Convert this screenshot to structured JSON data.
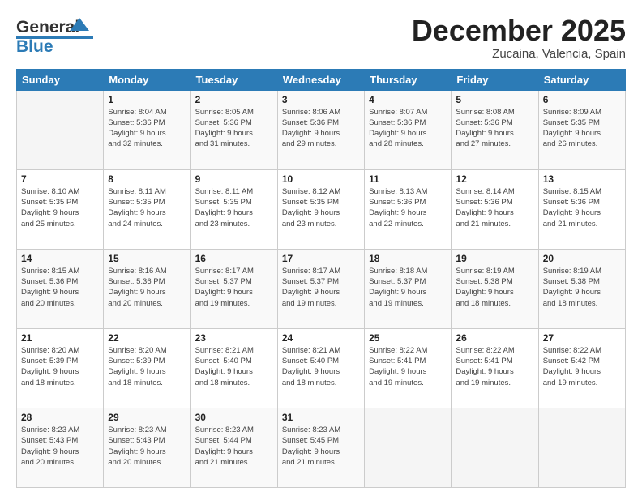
{
  "header": {
    "logo_general": "General",
    "logo_blue": "Blue",
    "title": "December 2025",
    "subtitle": "Zucaina, Valencia, Spain"
  },
  "calendar": {
    "days_of_week": [
      "Sunday",
      "Monday",
      "Tuesday",
      "Wednesday",
      "Thursday",
      "Friday",
      "Saturday"
    ],
    "weeks": [
      [
        {
          "day": "",
          "info": ""
        },
        {
          "day": "1",
          "info": "Sunrise: 8:04 AM\nSunset: 5:36 PM\nDaylight: 9 hours\nand 32 minutes."
        },
        {
          "day": "2",
          "info": "Sunrise: 8:05 AM\nSunset: 5:36 PM\nDaylight: 9 hours\nand 31 minutes."
        },
        {
          "day": "3",
          "info": "Sunrise: 8:06 AM\nSunset: 5:36 PM\nDaylight: 9 hours\nand 29 minutes."
        },
        {
          "day": "4",
          "info": "Sunrise: 8:07 AM\nSunset: 5:36 PM\nDaylight: 9 hours\nand 28 minutes."
        },
        {
          "day": "5",
          "info": "Sunrise: 8:08 AM\nSunset: 5:36 PM\nDaylight: 9 hours\nand 27 minutes."
        },
        {
          "day": "6",
          "info": "Sunrise: 8:09 AM\nSunset: 5:35 PM\nDaylight: 9 hours\nand 26 minutes."
        }
      ],
      [
        {
          "day": "7",
          "info": "Sunrise: 8:10 AM\nSunset: 5:35 PM\nDaylight: 9 hours\nand 25 minutes."
        },
        {
          "day": "8",
          "info": "Sunrise: 8:11 AM\nSunset: 5:35 PM\nDaylight: 9 hours\nand 24 minutes."
        },
        {
          "day": "9",
          "info": "Sunrise: 8:11 AM\nSunset: 5:35 PM\nDaylight: 9 hours\nand 23 minutes."
        },
        {
          "day": "10",
          "info": "Sunrise: 8:12 AM\nSunset: 5:35 PM\nDaylight: 9 hours\nand 23 minutes."
        },
        {
          "day": "11",
          "info": "Sunrise: 8:13 AM\nSunset: 5:36 PM\nDaylight: 9 hours\nand 22 minutes."
        },
        {
          "day": "12",
          "info": "Sunrise: 8:14 AM\nSunset: 5:36 PM\nDaylight: 9 hours\nand 21 minutes."
        },
        {
          "day": "13",
          "info": "Sunrise: 8:15 AM\nSunset: 5:36 PM\nDaylight: 9 hours\nand 21 minutes."
        }
      ],
      [
        {
          "day": "14",
          "info": "Sunrise: 8:15 AM\nSunset: 5:36 PM\nDaylight: 9 hours\nand 20 minutes."
        },
        {
          "day": "15",
          "info": "Sunrise: 8:16 AM\nSunset: 5:36 PM\nDaylight: 9 hours\nand 20 minutes."
        },
        {
          "day": "16",
          "info": "Sunrise: 8:17 AM\nSunset: 5:37 PM\nDaylight: 9 hours\nand 19 minutes."
        },
        {
          "day": "17",
          "info": "Sunrise: 8:17 AM\nSunset: 5:37 PM\nDaylight: 9 hours\nand 19 minutes."
        },
        {
          "day": "18",
          "info": "Sunrise: 8:18 AM\nSunset: 5:37 PM\nDaylight: 9 hours\nand 19 minutes."
        },
        {
          "day": "19",
          "info": "Sunrise: 8:19 AM\nSunset: 5:38 PM\nDaylight: 9 hours\nand 18 minutes."
        },
        {
          "day": "20",
          "info": "Sunrise: 8:19 AM\nSunset: 5:38 PM\nDaylight: 9 hours\nand 18 minutes."
        }
      ],
      [
        {
          "day": "21",
          "info": "Sunrise: 8:20 AM\nSunset: 5:39 PM\nDaylight: 9 hours\nand 18 minutes."
        },
        {
          "day": "22",
          "info": "Sunrise: 8:20 AM\nSunset: 5:39 PM\nDaylight: 9 hours\nand 18 minutes."
        },
        {
          "day": "23",
          "info": "Sunrise: 8:21 AM\nSunset: 5:40 PM\nDaylight: 9 hours\nand 18 minutes."
        },
        {
          "day": "24",
          "info": "Sunrise: 8:21 AM\nSunset: 5:40 PM\nDaylight: 9 hours\nand 18 minutes."
        },
        {
          "day": "25",
          "info": "Sunrise: 8:22 AM\nSunset: 5:41 PM\nDaylight: 9 hours\nand 19 minutes."
        },
        {
          "day": "26",
          "info": "Sunrise: 8:22 AM\nSunset: 5:41 PM\nDaylight: 9 hours\nand 19 minutes."
        },
        {
          "day": "27",
          "info": "Sunrise: 8:22 AM\nSunset: 5:42 PM\nDaylight: 9 hours\nand 19 minutes."
        }
      ],
      [
        {
          "day": "28",
          "info": "Sunrise: 8:23 AM\nSunset: 5:43 PM\nDaylight: 9 hours\nand 20 minutes."
        },
        {
          "day": "29",
          "info": "Sunrise: 8:23 AM\nSunset: 5:43 PM\nDaylight: 9 hours\nand 20 minutes."
        },
        {
          "day": "30",
          "info": "Sunrise: 8:23 AM\nSunset: 5:44 PM\nDaylight: 9 hours\nand 21 minutes."
        },
        {
          "day": "31",
          "info": "Sunrise: 8:23 AM\nSunset: 5:45 PM\nDaylight: 9 hours\nand 21 minutes."
        },
        {
          "day": "",
          "info": ""
        },
        {
          "day": "",
          "info": ""
        },
        {
          "day": "",
          "info": ""
        }
      ]
    ]
  }
}
